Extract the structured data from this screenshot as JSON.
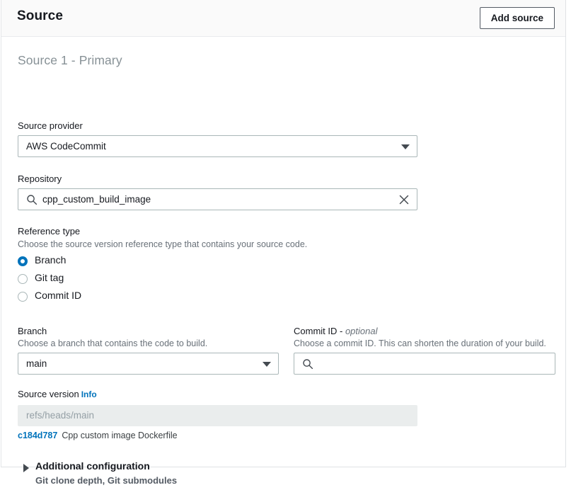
{
  "header": {
    "title": "Source",
    "add_source_label": "Add source"
  },
  "source": {
    "section_heading": "Source 1 - Primary",
    "provider": {
      "label": "Source provider",
      "value": "AWS CodeCommit",
      "caret_icon": "chevron-down-icon"
    },
    "repository": {
      "label": "Repository",
      "value": "cpp_custom_build_image",
      "search_icon": "search-icon",
      "clear_icon": "close-icon"
    },
    "reference_type": {
      "label": "Reference type",
      "description": "Choose the source version reference type that contains your source code.",
      "options": [
        {
          "label": "Branch",
          "selected": true
        },
        {
          "label": "Git tag",
          "selected": false
        },
        {
          "label": "Commit ID",
          "selected": false
        }
      ]
    },
    "branch": {
      "label": "Branch",
      "description": "Choose a branch that contains the code to build.",
      "value": "main",
      "caret_icon": "chevron-down-icon"
    },
    "commit_id": {
      "label": "Commit ID - ",
      "label_optional": "optional",
      "description": "Choose a commit ID. This can shorten the duration of your build.",
      "value": "",
      "search_icon": "search-icon"
    },
    "source_version": {
      "label": "Source version",
      "info_label": "Info",
      "value": "refs/heads/main",
      "commit_hash": "c184d787",
      "commit_message": "Cpp custom image Dockerfile"
    },
    "additional_configuration": {
      "title": "Additional configuration",
      "subtitle": "Git clone depth, Git submodules",
      "expanded": false,
      "triangle_icon": "triangle-right-icon"
    }
  },
  "colors": {
    "accent": "#0073bb",
    "header_bg": "#fafafa",
    "border": "#aab7b8",
    "disabled_bg": "#eaeded",
    "muted_text": "#687078"
  }
}
